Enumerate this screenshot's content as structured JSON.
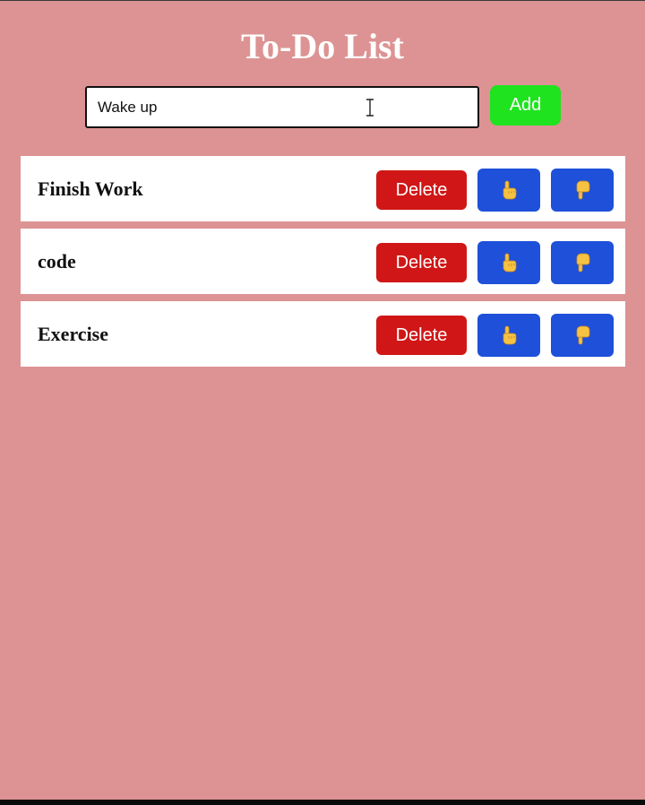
{
  "header": {
    "title": "To-Do List"
  },
  "input": {
    "value": "Wake up",
    "add_label": "Add"
  },
  "tasks": [
    {
      "text": "Finish Work",
      "delete_label": "Delete"
    },
    {
      "text": "code",
      "delete_label": "Delete"
    },
    {
      "text": "Exercise",
      "delete_label": "Delete"
    }
  ],
  "icons": {
    "move_up": "pointing-up-hand-icon",
    "move_down": "pointing-down-hand-icon"
  },
  "colors": {
    "background": "#dd9393",
    "add_button": "#1fe31f",
    "delete_button": "#d01616",
    "move_button": "#1e50d9",
    "hand_icon": "#f6c244"
  }
}
